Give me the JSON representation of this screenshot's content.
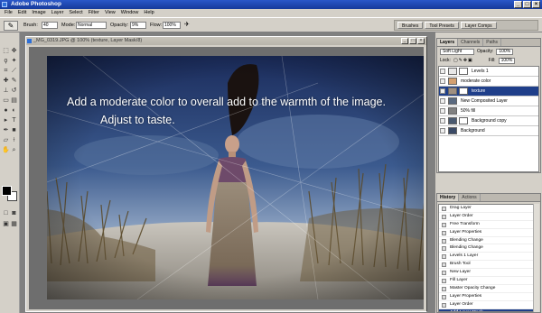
{
  "app": {
    "title": "Adobe Photoshop",
    "window_buttons": [
      "_",
      "□",
      "×"
    ]
  },
  "menubar": [
    "File",
    "Edit",
    "Image",
    "Layer",
    "Select",
    "Filter",
    "View",
    "Window",
    "Help"
  ],
  "options": {
    "brush_label": "Brush:",
    "brush_size": "40",
    "mode_label": "Mode:",
    "mode_value": "Normal",
    "opacity_label": "Opacity:",
    "opacity_value": "9%",
    "flow_label": "Flow:",
    "flow_value": "100%",
    "well_tabs": [
      "Brushes",
      "Tool Presets",
      "Layer Comps"
    ]
  },
  "document": {
    "title": "_MG_0319.JPG @ 100% (texture, Layer Mask/8)",
    "overlay_line1": "Add a moderate color to overall add to the warmth of the image.",
    "overlay_line2": "Adjust to taste."
  },
  "layers_panel": {
    "tabs": [
      "Layers",
      "Channels",
      "Paths"
    ],
    "blend_mode": "Soft Light",
    "opacity_label": "Opacity:",
    "opacity_value": "100%",
    "lock_label": "Lock:",
    "fill_label": "Fill:",
    "fill_value": "100%",
    "layers": [
      {
        "name": "Levels 1",
        "thumb": "#e8e8e8",
        "mask": true,
        "selected": false
      },
      {
        "name": "moderate color",
        "thumb": "#d4a070",
        "mask": false,
        "selected": false
      },
      {
        "name": "texture",
        "thumb": "#a09080",
        "mask": true,
        "selected": true
      },
      {
        "name": "New Composited Layer",
        "thumb": "#5a6a80",
        "mask": false,
        "selected": false
      },
      {
        "name": "50% fill",
        "thumb": "#808080",
        "mask": false,
        "selected": false
      },
      {
        "name": "Background copy",
        "thumb": "#4a5a70",
        "mask": true,
        "selected": false
      },
      {
        "name": "Background",
        "thumb": "#3a4a66",
        "mask": false,
        "selected": false
      }
    ]
  },
  "history_panel": {
    "tabs": [
      "History",
      "Actions"
    ],
    "items": [
      "Drag Layer",
      "Layer Order",
      "Free Transform",
      "Layer Properties",
      "Blending Change",
      "Blending Change",
      "Levels 1 Layer",
      "Brush Tool",
      "New Layer",
      "Fill Layer",
      "Master Opacity Change",
      "Layer Properties",
      "Layer Order",
      "Add Layer Mask"
    ],
    "selected_index": 13
  },
  "colors": {
    "selection": "#1f3f8a",
    "titlebar": "#2a57c9",
    "chrome": "#d4d0c8",
    "workspace": "#808080"
  }
}
